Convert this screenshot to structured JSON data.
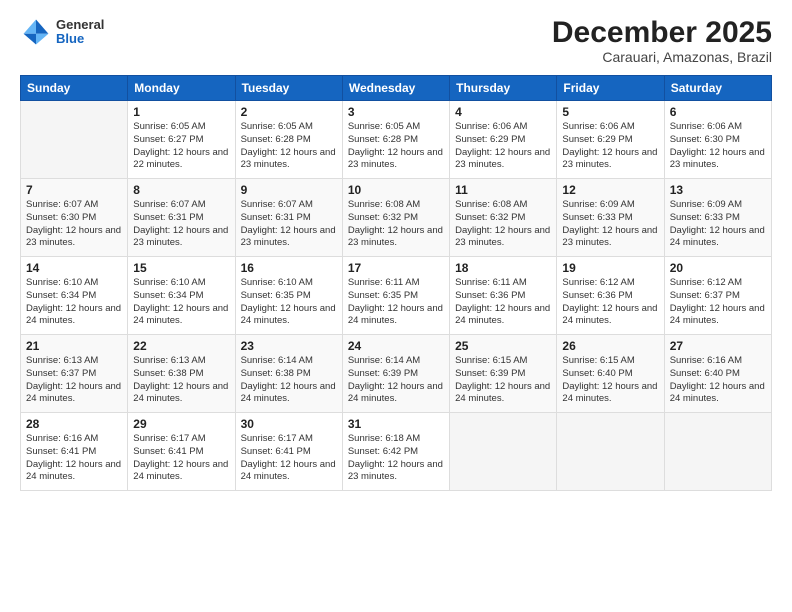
{
  "logo": {
    "general": "General",
    "blue": "Blue"
  },
  "header": {
    "title": "December 2025",
    "subtitle": "Carauari, Amazonas, Brazil"
  },
  "weekdays": [
    "Sunday",
    "Monday",
    "Tuesday",
    "Wednesday",
    "Thursday",
    "Friday",
    "Saturday"
  ],
  "weeks": [
    [
      {
        "day": "",
        "sunrise": "",
        "sunset": "",
        "daylight": ""
      },
      {
        "day": "1",
        "sunrise": "Sunrise: 6:05 AM",
        "sunset": "Sunset: 6:27 PM",
        "daylight": "Daylight: 12 hours and 22 minutes."
      },
      {
        "day": "2",
        "sunrise": "Sunrise: 6:05 AM",
        "sunset": "Sunset: 6:28 PM",
        "daylight": "Daylight: 12 hours and 23 minutes."
      },
      {
        "day": "3",
        "sunrise": "Sunrise: 6:05 AM",
        "sunset": "Sunset: 6:28 PM",
        "daylight": "Daylight: 12 hours and 23 minutes."
      },
      {
        "day": "4",
        "sunrise": "Sunrise: 6:06 AM",
        "sunset": "Sunset: 6:29 PM",
        "daylight": "Daylight: 12 hours and 23 minutes."
      },
      {
        "day": "5",
        "sunrise": "Sunrise: 6:06 AM",
        "sunset": "Sunset: 6:29 PM",
        "daylight": "Daylight: 12 hours and 23 minutes."
      },
      {
        "day": "6",
        "sunrise": "Sunrise: 6:06 AM",
        "sunset": "Sunset: 6:30 PM",
        "daylight": "Daylight: 12 hours and 23 minutes."
      }
    ],
    [
      {
        "day": "7",
        "sunrise": "Sunrise: 6:07 AM",
        "sunset": "Sunset: 6:30 PM",
        "daylight": "Daylight: 12 hours and 23 minutes."
      },
      {
        "day": "8",
        "sunrise": "Sunrise: 6:07 AM",
        "sunset": "Sunset: 6:31 PM",
        "daylight": "Daylight: 12 hours and 23 minutes."
      },
      {
        "day": "9",
        "sunrise": "Sunrise: 6:07 AM",
        "sunset": "Sunset: 6:31 PM",
        "daylight": "Daylight: 12 hours and 23 minutes."
      },
      {
        "day": "10",
        "sunrise": "Sunrise: 6:08 AM",
        "sunset": "Sunset: 6:32 PM",
        "daylight": "Daylight: 12 hours and 23 minutes."
      },
      {
        "day": "11",
        "sunrise": "Sunrise: 6:08 AM",
        "sunset": "Sunset: 6:32 PM",
        "daylight": "Daylight: 12 hours and 23 minutes."
      },
      {
        "day": "12",
        "sunrise": "Sunrise: 6:09 AM",
        "sunset": "Sunset: 6:33 PM",
        "daylight": "Daylight: 12 hours and 23 minutes."
      },
      {
        "day": "13",
        "sunrise": "Sunrise: 6:09 AM",
        "sunset": "Sunset: 6:33 PM",
        "daylight": "Daylight: 12 hours and 24 minutes."
      }
    ],
    [
      {
        "day": "14",
        "sunrise": "Sunrise: 6:10 AM",
        "sunset": "Sunset: 6:34 PM",
        "daylight": "Daylight: 12 hours and 24 minutes."
      },
      {
        "day": "15",
        "sunrise": "Sunrise: 6:10 AM",
        "sunset": "Sunset: 6:34 PM",
        "daylight": "Daylight: 12 hours and 24 minutes."
      },
      {
        "day": "16",
        "sunrise": "Sunrise: 6:10 AM",
        "sunset": "Sunset: 6:35 PM",
        "daylight": "Daylight: 12 hours and 24 minutes."
      },
      {
        "day": "17",
        "sunrise": "Sunrise: 6:11 AM",
        "sunset": "Sunset: 6:35 PM",
        "daylight": "Daylight: 12 hours and 24 minutes."
      },
      {
        "day": "18",
        "sunrise": "Sunrise: 6:11 AM",
        "sunset": "Sunset: 6:36 PM",
        "daylight": "Daylight: 12 hours and 24 minutes."
      },
      {
        "day": "19",
        "sunrise": "Sunrise: 6:12 AM",
        "sunset": "Sunset: 6:36 PM",
        "daylight": "Daylight: 12 hours and 24 minutes."
      },
      {
        "day": "20",
        "sunrise": "Sunrise: 6:12 AM",
        "sunset": "Sunset: 6:37 PM",
        "daylight": "Daylight: 12 hours and 24 minutes."
      }
    ],
    [
      {
        "day": "21",
        "sunrise": "Sunrise: 6:13 AM",
        "sunset": "Sunset: 6:37 PM",
        "daylight": "Daylight: 12 hours and 24 minutes."
      },
      {
        "day": "22",
        "sunrise": "Sunrise: 6:13 AM",
        "sunset": "Sunset: 6:38 PM",
        "daylight": "Daylight: 12 hours and 24 minutes."
      },
      {
        "day": "23",
        "sunrise": "Sunrise: 6:14 AM",
        "sunset": "Sunset: 6:38 PM",
        "daylight": "Daylight: 12 hours and 24 minutes."
      },
      {
        "day": "24",
        "sunrise": "Sunrise: 6:14 AM",
        "sunset": "Sunset: 6:39 PM",
        "daylight": "Daylight: 12 hours and 24 minutes."
      },
      {
        "day": "25",
        "sunrise": "Sunrise: 6:15 AM",
        "sunset": "Sunset: 6:39 PM",
        "daylight": "Daylight: 12 hours and 24 minutes."
      },
      {
        "day": "26",
        "sunrise": "Sunrise: 6:15 AM",
        "sunset": "Sunset: 6:40 PM",
        "daylight": "Daylight: 12 hours and 24 minutes."
      },
      {
        "day": "27",
        "sunrise": "Sunrise: 6:16 AM",
        "sunset": "Sunset: 6:40 PM",
        "daylight": "Daylight: 12 hours and 24 minutes."
      }
    ],
    [
      {
        "day": "28",
        "sunrise": "Sunrise: 6:16 AM",
        "sunset": "Sunset: 6:41 PM",
        "daylight": "Daylight: 12 hours and 24 minutes."
      },
      {
        "day": "29",
        "sunrise": "Sunrise: 6:17 AM",
        "sunset": "Sunset: 6:41 PM",
        "daylight": "Daylight: 12 hours and 24 minutes."
      },
      {
        "day": "30",
        "sunrise": "Sunrise: 6:17 AM",
        "sunset": "Sunset: 6:41 PM",
        "daylight": "Daylight: 12 hours and 24 minutes."
      },
      {
        "day": "31",
        "sunrise": "Sunrise: 6:18 AM",
        "sunset": "Sunset: 6:42 PM",
        "daylight": "Daylight: 12 hours and 23 minutes."
      },
      {
        "day": "",
        "sunrise": "",
        "sunset": "",
        "daylight": ""
      },
      {
        "day": "",
        "sunrise": "",
        "sunset": "",
        "daylight": ""
      },
      {
        "day": "",
        "sunrise": "",
        "sunset": "",
        "daylight": ""
      }
    ]
  ]
}
